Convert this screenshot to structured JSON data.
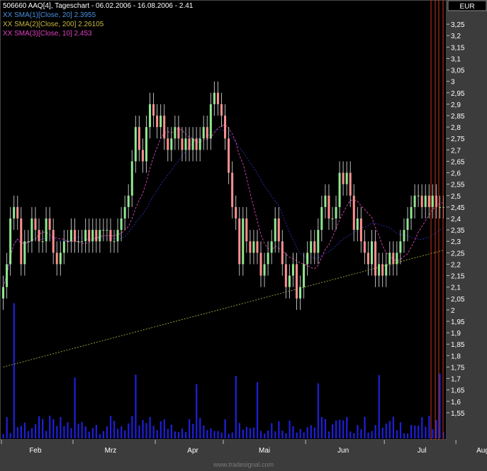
{
  "header": {
    "title": "506660  AAQ[4], Tageschart - 06.02.2006 - 16.08.2006 - 2.41",
    "sma20": "XX SMA(1)[Close, 20] 2.3955",
    "sma200": "XX SMA(2)[Close, 200] 2.26105",
    "sma10": "XX SMA(3)[Close, 10] 2.453"
  },
  "currency_label": "EUR",
  "watermark": "www.tradesignal.com",
  "colors": {
    "background": "#000000",
    "bull": "#90e890",
    "bear": "#ff9090",
    "volume": "#1f1fdc",
    "sma20": "#2a2aa8",
    "sma200": "#9a9a40",
    "sma10": "#c040a0",
    "marker_lines": "#c83a1a",
    "axis_text": "#ffffff"
  },
  "chart_data": {
    "type": "candlestick",
    "title": "506660 AAQ[4], Tageschart - 06.02.2006 - 16.08.2006 - 2.41",
    "currency": "EUR",
    "price_axis": {
      "ylim": [
        1.5,
        3.3
      ],
      "ticks": [
        "3,25",
        "3,2",
        "3,15",
        "3,1",
        "3,05",
        "3",
        "2,95",
        "2,9",
        "2,85",
        "2,8",
        "2,75",
        "2,7",
        "2,65",
        "2,6",
        "2,55",
        "2,5",
        "2,45",
        "2,4",
        "2,35",
        "2,3",
        "2,25",
        "2,2",
        "2,15",
        "2,1",
        "2,05",
        "2",
        "1,95",
        "1,9",
        "1,85",
        "1,8",
        "1,75",
        "1,7",
        "1,65",
        "1,6",
        "1,55"
      ]
    },
    "months": [
      "Feb",
      "Mrz",
      "Apr",
      "Mai",
      "Jun",
      "Jul",
      "Aug"
    ],
    "month_start_index": [
      0,
      20,
      43,
      62,
      85,
      107,
      127
    ],
    "month_label_index": [
      9,
      30,
      53,
      73,
      95,
      117,
      134
    ],
    "close": [
      2.1,
      2.2,
      2.4,
      2.45,
      2.4,
      2.2,
      2.3,
      2.3,
      2.4,
      2.35,
      2.3,
      2.3,
      2.4,
      2.35,
      2.25,
      2.2,
      2.25,
      2.3,
      2.3,
      2.35,
      2.3,
      2.3,
      2.3,
      2.35,
      2.3,
      2.35,
      2.3,
      2.35,
      2.35,
      2.35,
      2.3,
      2.3,
      2.35,
      2.4,
      2.45,
      2.5,
      2.65,
      2.8,
      2.7,
      2.65,
      2.8,
      2.9,
      2.85,
      2.8,
      2.85,
      2.75,
      2.7,
      2.75,
      2.8,
      2.75,
      2.7,
      2.75,
      2.7,
      2.75,
      2.7,
      2.75,
      2.8,
      2.75,
      2.9,
      2.95,
      2.9,
      2.85,
      2.75,
      2.6,
      2.45,
      2.4,
      2.2,
      2.4,
      2.3,
      2.25,
      2.3,
      2.25,
      2.15,
      2.2,
      2.25,
      2.3,
      2.4,
      2.3,
      2.2,
      2.1,
      2.15,
      2.2,
      2.05,
      2.1,
      2.2,
      2.25,
      2.3,
      2.25,
      2.35,
      2.45,
      2.5,
      2.4,
      2.4,
      2.45,
      2.6,
      2.55,
      2.6,
      2.5,
      2.35,
      2.4,
      2.3,
      2.25,
      2.2,
      2.3,
      2.15,
      2.2,
      2.15,
      2.2,
      2.25,
      2.2,
      2.25,
      2.3,
      2.35,
      2.4,
      2.45,
      2.5,
      2.5,
      2.45,
      2.5,
      2.45,
      2.5,
      2.45,
      2.45,
      2.45
    ],
    "volume_axis": {
      "note": "volume bars share the lower portion of the price panel; no printed scale"
    },
    "series": [
      {
        "name": "SMA(1)[Close, 20]",
        "last_value": 2.3955
      },
      {
        "name": "SMA(2)[Close, 200]",
        "last_value": 2.26105
      },
      {
        "name": "SMA(3)[Close, 10]",
        "last_value": 2.453
      }
    ],
    "grid": false
  }
}
